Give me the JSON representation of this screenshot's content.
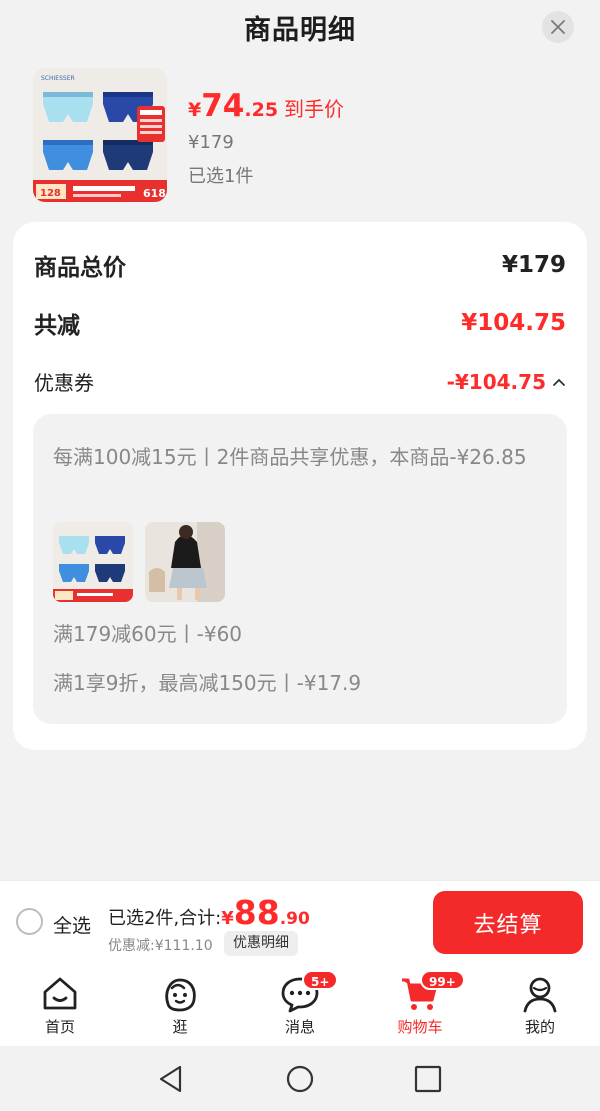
{
  "header": {
    "title": "商品明细"
  },
  "product": {
    "image_brand": "SCHIESSER",
    "image_promo_price": "128",
    "image_badge": "618",
    "price_symbol": "¥",
    "price_int": "74",
    "price_dec": ".25",
    "price_tag": "到手价",
    "original_price": "¥179",
    "selected_count": "已选1件"
  },
  "summary": {
    "total_label": "商品总价",
    "total_value": "¥179",
    "reduce_label": "共减",
    "reduce_value": "¥104.75",
    "coupon_label": "优惠券",
    "coupon_value": "-¥104.75"
  },
  "coupons": {
    "line1": "每满100减15元丨2件商品共享优惠，本商品-¥26.85",
    "line2": "满179减60元丨-¥60",
    "line3": "满1享9折，最高减150元丨-¥17.9"
  },
  "checkout": {
    "select_all": "全选",
    "selected_text": "已选2件,合计:",
    "sum_symbol": "¥",
    "sum_int": "88",
    "sum_dec": ".90",
    "saved": "优惠减:¥111.10",
    "detail_button": "优惠明细",
    "checkout_button": "去结算"
  },
  "tabbar": {
    "home": "首页",
    "browse": "逛",
    "messages": "消息",
    "messages_badge": "5+",
    "cart": "购物车",
    "cart_badge": "99+",
    "me": "我的"
  },
  "colors": {
    "accent": "#f42a2a",
    "muted": "#888888"
  }
}
